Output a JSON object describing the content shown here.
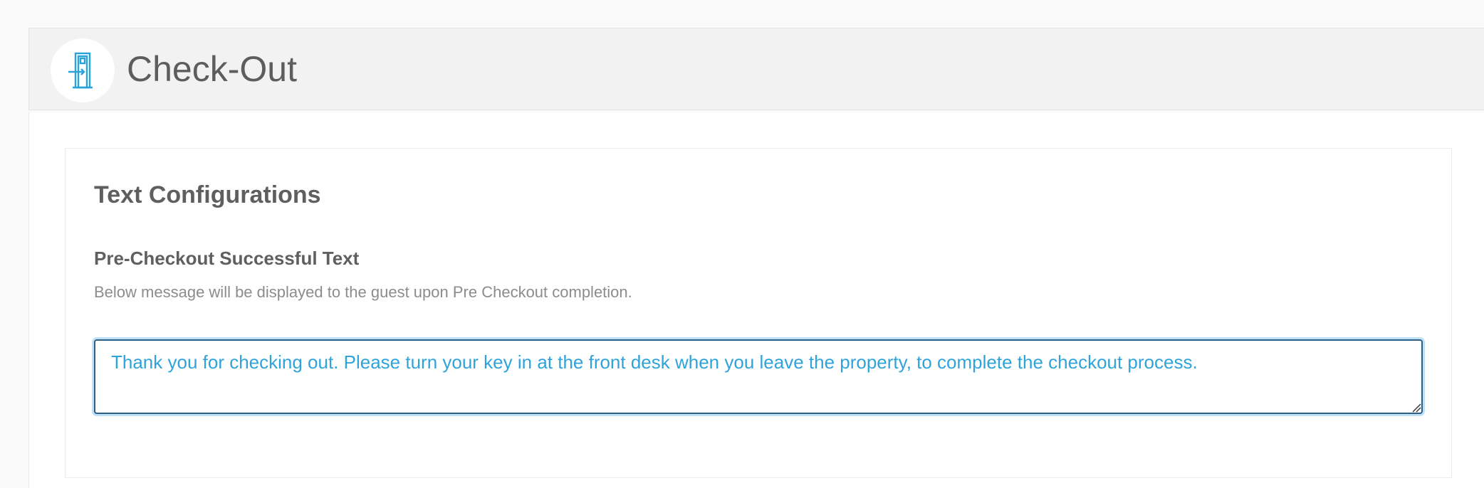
{
  "header": {
    "title": "Check-Out",
    "icon": "door-exit-icon",
    "icon_color": "#2aa3d8"
  },
  "card": {
    "section_title": "Text Configurations",
    "field": {
      "label": "Pre-Checkout Successful Text",
      "help": "Below message will be displayed to the guest upon Pre Checkout completion.",
      "value": "Thank you for checking out. Please turn your key in at the front desk when you leave the property, to complete the checkout process.",
      "text_color": "#2fa3da",
      "focus_border_color": "#2d5f86"
    }
  }
}
